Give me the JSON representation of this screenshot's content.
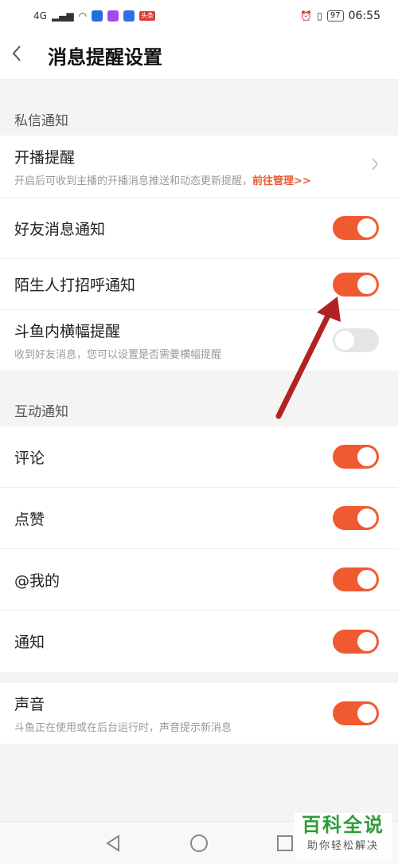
{
  "status_bar": {
    "network": "4G",
    "news_badge": "头条",
    "battery": "97",
    "time": "06:55"
  },
  "header": {
    "back_icon": "chevron-left-icon",
    "title": "消息提醒设置"
  },
  "sections": [
    {
      "title": "私信通知",
      "rows": [
        {
          "title": "开播提醒",
          "subtitle": "开启后可收到主播的开播消息推送和动态更新提醒，",
          "link": "前往管理>>",
          "control": "chevron"
        },
        {
          "title": "好友消息通知",
          "control": "toggle",
          "on": true
        },
        {
          "title": "陌生人打招呼通知",
          "control": "toggle",
          "on": true
        },
        {
          "title": "斗鱼内横幅提醒",
          "subtitle": "收到好友消息，您可以设置是否需要横幅提醒",
          "control": "toggle",
          "on": false
        }
      ]
    },
    {
      "title": "互动通知",
      "rows": [
        {
          "title": "评论",
          "control": "toggle",
          "on": true
        },
        {
          "title": "点赞",
          "control": "toggle",
          "on": true
        },
        {
          "title": "@我的",
          "control": "toggle",
          "on": true
        },
        {
          "title": "通知",
          "control": "toggle",
          "on": true
        }
      ]
    },
    {
      "title": "",
      "rows": [
        {
          "title": "声音",
          "subtitle": "斗鱼正在使用或在后台运行时，声音提示新消息",
          "control": "toggle",
          "on": true
        }
      ]
    }
  ],
  "watermark": {
    "big": "百科全说",
    "small": "助你轻松解决"
  },
  "colors": {
    "accent": "#f05a30",
    "toggle_off": "#e5e5e5",
    "arrow": "#b22222",
    "link": "#e85a2e"
  }
}
